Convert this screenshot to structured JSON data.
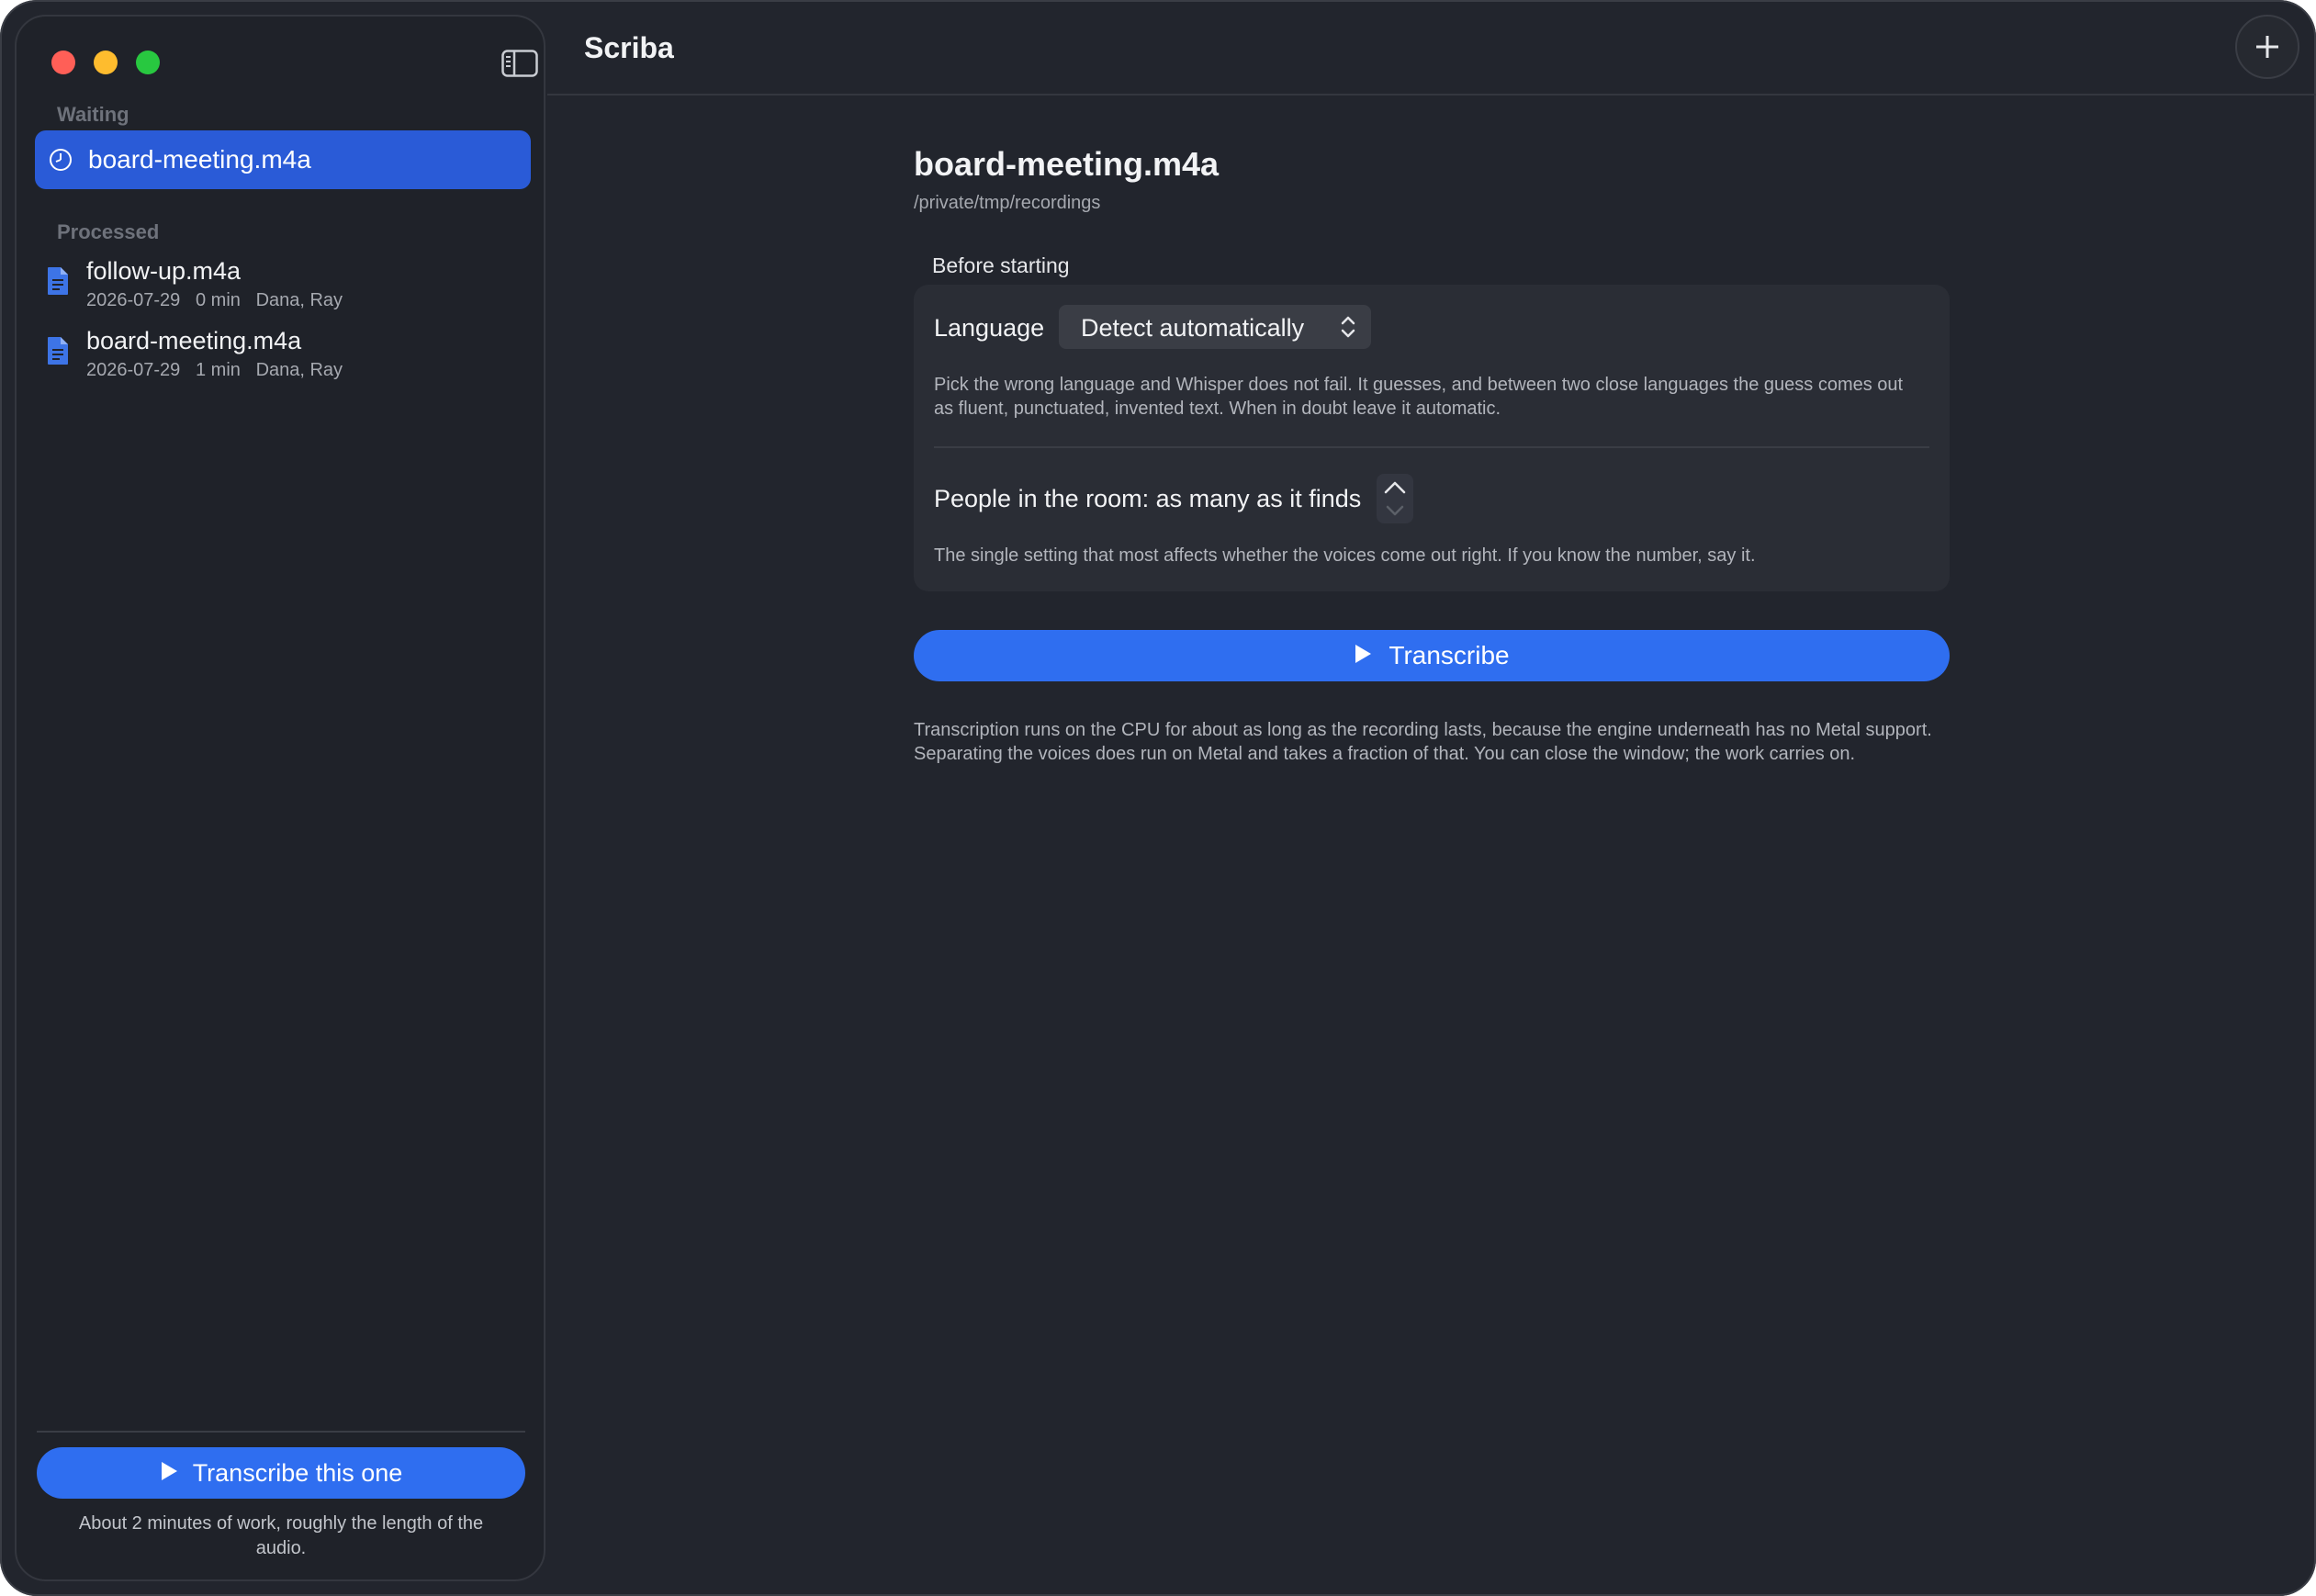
{
  "app": {
    "title": "Scriba"
  },
  "sidebar": {
    "waiting_label": "Waiting",
    "waiting_items": [
      {
        "name": "board-meeting.m4a",
        "icon": "clock-icon"
      }
    ],
    "processed_label": "Processed",
    "processed_items": [
      {
        "name": "follow-up.m4a",
        "date": "2026-07-29",
        "duration": "0 min",
        "speakers": "Dana, Ray",
        "icon": "document-icon"
      },
      {
        "name": "board-meeting.m4a",
        "date": "2026-07-29",
        "duration": "1 min",
        "speakers": "Dana, Ray",
        "icon": "document-icon"
      }
    ],
    "button_label": "Transcribe this one",
    "note": "About 2 minutes of work, roughly the length of the audio."
  },
  "detail": {
    "file_name": "board-meeting.m4a",
    "file_path": "/private/tmp/recordings",
    "section_label": "Before starting",
    "language": {
      "label": "Language",
      "value": "Detect automatically",
      "help": "Pick the wrong language and Whisper does not fail. It guesses, and between two close languages the guess comes out as fluent, punctuated, invented text. When in doubt leave it automatic."
    },
    "people": {
      "label": "People in the room: as many as it finds",
      "help": "The single setting that most affects whether the voices come out right. If you know the number, say it."
    },
    "transcribe_label": "Transcribe",
    "note": "Transcription runs on the CPU for about as long as the recording lasts, because the engine underneath has no Metal support. Separating the voices does run on Metal and takes a fraction of that. You can close the window; the work carries on."
  },
  "colors": {
    "accent": "#2f6ef0",
    "selection": "#2a5bd7",
    "background": "#22252d"
  }
}
